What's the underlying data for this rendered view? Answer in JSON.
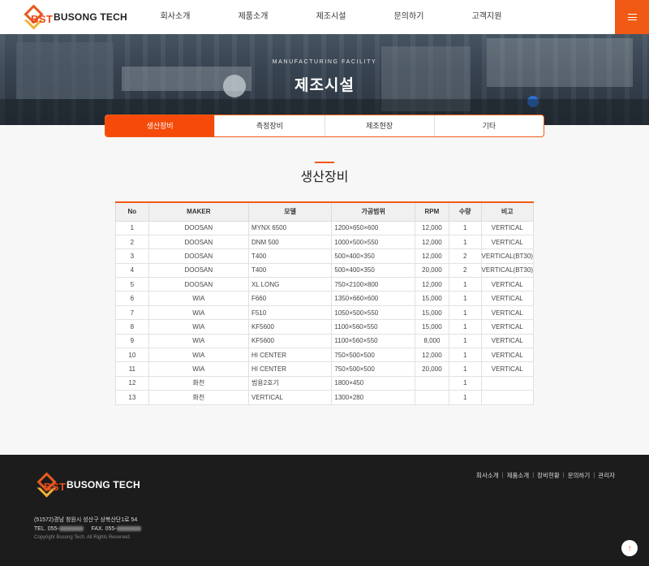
{
  "header": {
    "logo_mark": "BST",
    "logo_text": "BUSONG TECH",
    "nav": [
      "회사소개",
      "제품소개",
      "제조시설",
      "문의하기",
      "고객지원"
    ],
    "menu_icon": "hamburger-icon"
  },
  "hero": {
    "subtitle": "MANUFACTURING FACILITY",
    "title": "제조시설"
  },
  "tabs": [
    "생산장비",
    "측정장비",
    "제조현장",
    "기타"
  ],
  "active_tab": 0,
  "section": {
    "title": "생산장비"
  },
  "table": {
    "headers": [
      "No",
      "MAKER",
      "모델",
      "가공범위",
      "RPM",
      "수량",
      "비고"
    ],
    "rows": [
      [
        "1",
        "DOOSAN",
        "MYNX 6500",
        "1200×650×600",
        "12,000",
        "1",
        "VERTICAL"
      ],
      [
        "2",
        "DOOSAN",
        "DNM 500",
        "1000×500×550",
        "12,000",
        "1",
        "VERTICAL"
      ],
      [
        "3",
        "DOOSAN",
        "T400",
        "500×400×350",
        "12,000",
        "2",
        "VERTICAL(BT30)"
      ],
      [
        "4",
        "DOOSAN",
        "T400",
        "500×400×350",
        "20,000",
        "2",
        "VERTICAL(BT30)"
      ],
      [
        "5",
        "DOOSAN",
        "XL LONG",
        "750×2100×800",
        "12,000",
        "1",
        "VERTICAL"
      ],
      [
        "6",
        "WIA",
        "F660",
        "1350×660×600",
        "15,000",
        "1",
        "VERTICAL"
      ],
      [
        "7",
        "WIA",
        "F510",
        "1050×500×550",
        "15,000",
        "1",
        "VERTICAL"
      ],
      [
        "8",
        "WIA",
        "KF5600",
        "1100×560×550",
        "15,000",
        "1",
        "VERTICAL"
      ],
      [
        "9",
        "WIA",
        "KF5600",
        "1100×560×550",
        "8,000",
        "1",
        "VERTICAL"
      ],
      [
        "10",
        "WIA",
        "HI CENTER",
        "750×500×500",
        "12,000",
        "1",
        "VERTICAL"
      ],
      [
        "11",
        "WIA",
        "HI CENTER",
        "750×500×500",
        "20,000",
        "1",
        "VERTICAL"
      ],
      [
        "12",
        "화천",
        "범용2호기",
        "1800×450",
        "",
        "1",
        ""
      ],
      [
        "13",
        "화천",
        "VERTICAL",
        "1300×280",
        "",
        "1",
        ""
      ]
    ]
  },
  "footer": {
    "logo_mark": "BST",
    "logo_text": "BUSONG TECH",
    "links": [
      "회사소개",
      "제품소개",
      "장비현황",
      "문의하기",
      "관리자"
    ],
    "address": "(51572)경남 창원시 성산구 상복산단1로 54",
    "tel_label": "TEL. 055-",
    "fax_label": "FAX. 055-",
    "copyright": "Copyright Busong Tech. All Rights Reserved."
  },
  "top_button": "↑",
  "colors": {
    "accent": "#f05a14",
    "footer_bg": "#1c1c1c"
  }
}
